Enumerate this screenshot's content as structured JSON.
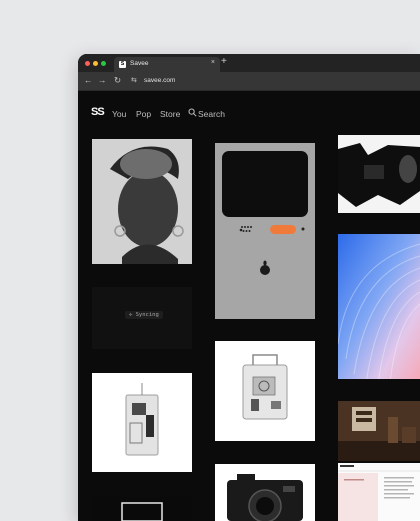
{
  "browser": {
    "tab": {
      "favicon": "S",
      "title": "Savee",
      "close_glyph": "×"
    },
    "new_tab_glyph": "+",
    "nav": {
      "back": "←",
      "forward": "→",
      "reload": "↻"
    },
    "url_icon": "⇆",
    "url": "savee.com"
  },
  "site": {
    "logo": "SS",
    "nav": [
      "You",
      "Pop",
      "Store"
    ],
    "search_label": "Search",
    "search_icon": "magnifier-icon"
  },
  "feed": {
    "syncing_text": "✢ Syncing"
  },
  "colors": {
    "page_bg": "#e7e8ea",
    "app_bg": "#0b0b0b",
    "tabbar": "#232323",
    "toolbar": "#363636",
    "close_dot": "#ff5f57",
    "minimize_dot": "#febc2e",
    "maximize_dot": "#28c840",
    "device_orange": "#f07a3a"
  }
}
